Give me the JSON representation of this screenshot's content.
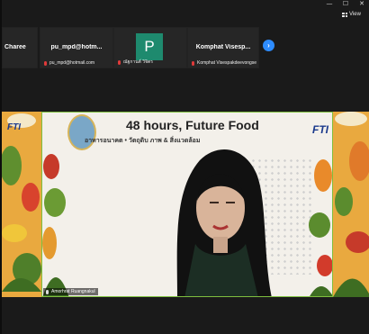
{
  "window": {
    "minimize": "—",
    "maximize": "☐",
    "close": "✕"
  },
  "toolbar": {
    "view_label": "View"
  },
  "participants": [
    {
      "name": "Charee",
      "meta": ""
    },
    {
      "name": "pu_mpd@hotm...",
      "meta": "pu_mpd@hotmail.com"
    },
    {
      "name": "",
      "avatar_letter": "P",
      "meta": "ณัฐกานต์ วิจิตร"
    },
    {
      "name": "Komphat Visesp...",
      "meta": "Komphat Visespakdeevongse"
    }
  ],
  "speaker": {
    "name": "Amorhrat Ruangnakul"
  },
  "banner": {
    "title": "48 hours, Future Food",
    "subtitle": "อาหารอนาคต • วัตถุดิบ                                ภาพ & สิ่งแวดล้อม",
    "logo": "FTI"
  },
  "colors": {
    "accent": "#2d8cff",
    "avatar": "#1e8a6e",
    "active_border": "#7fbf3f"
  }
}
